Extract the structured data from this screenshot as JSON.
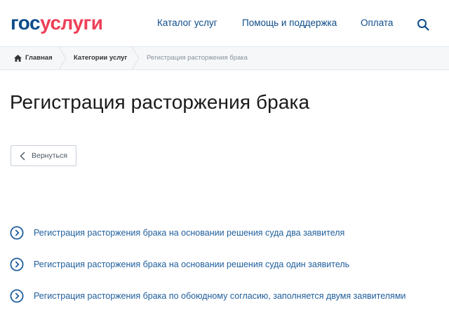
{
  "header": {
    "logo_part1": "гос",
    "logo_part2": "услуги",
    "nav": [
      "Каталог услуг",
      "Помощь и поддержка",
      "Оплата"
    ],
    "search_icon": "search-icon"
  },
  "breadcrumbs": {
    "items": [
      "Главная",
      "Категории услуг",
      "Регистрация расторжения брака"
    ]
  },
  "page": {
    "title": "Регистрация расторжения брака",
    "back_label": "Вернуться"
  },
  "services": [
    "Регистрация расторжения брака на основании решения суда два заявителя",
    "Регистрация расторжения брака на основании решения суда один заявитель",
    "Регистрация расторжения брака по обоюдному согласию, заполняется двумя заявителями"
  ],
  "colors": {
    "brand_blue": "#0d4c8a",
    "brand_red": "#ee3f58",
    "link_blue": "#1f5e9c"
  }
}
